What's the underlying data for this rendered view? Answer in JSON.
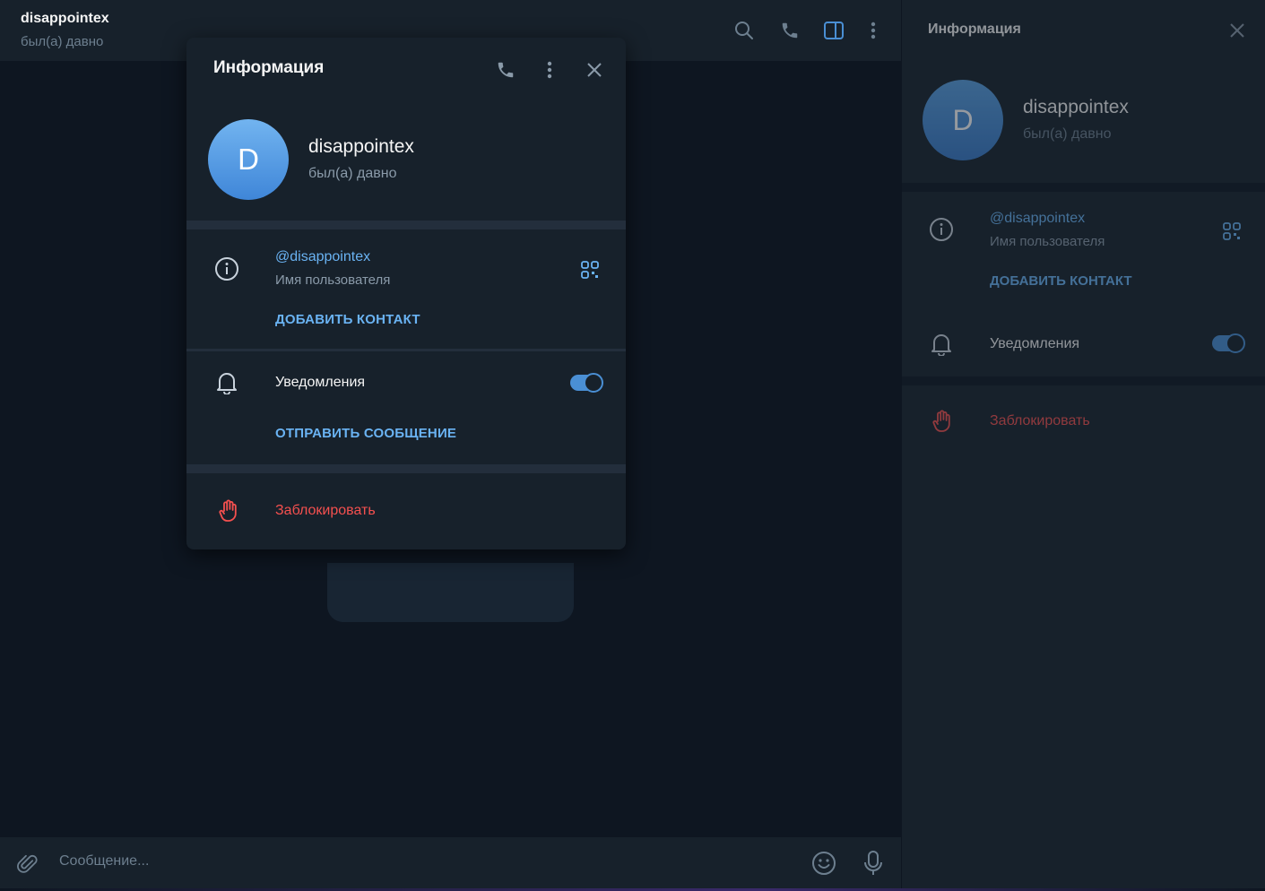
{
  "chat": {
    "title": "disappointex",
    "status": "был(а) давно",
    "composer_placeholder": "Сообщение..."
  },
  "sidebar": {
    "title": "Информация",
    "avatar_letter": "D",
    "name": "disappointex",
    "status": "был(а) давно",
    "username": "@disappointex",
    "username_caption": "Имя пользователя",
    "add_contact": "ДОБАВИТЬ КОНТАКТ",
    "notifications": "Уведомления",
    "notifications_enabled": true,
    "block": "Заблокировать"
  },
  "modal": {
    "title": "Информация",
    "avatar_letter": "D",
    "name": "disappointex",
    "status": "был(а) давно",
    "username": "@disappointex",
    "username_caption": "Имя пользователя",
    "add_contact": "ДОБАВИТЬ КОНТАКТ",
    "notifications": "Уведомления",
    "notifications_enabled": true,
    "send_message": "ОТПРАВИТЬ СООБЩЕНИЕ",
    "block": "Заблокировать"
  },
  "colors": {
    "accent": "#6ab3f3",
    "danger": "#f5504f",
    "panel": "#17212b",
    "background": "#0e1621"
  }
}
